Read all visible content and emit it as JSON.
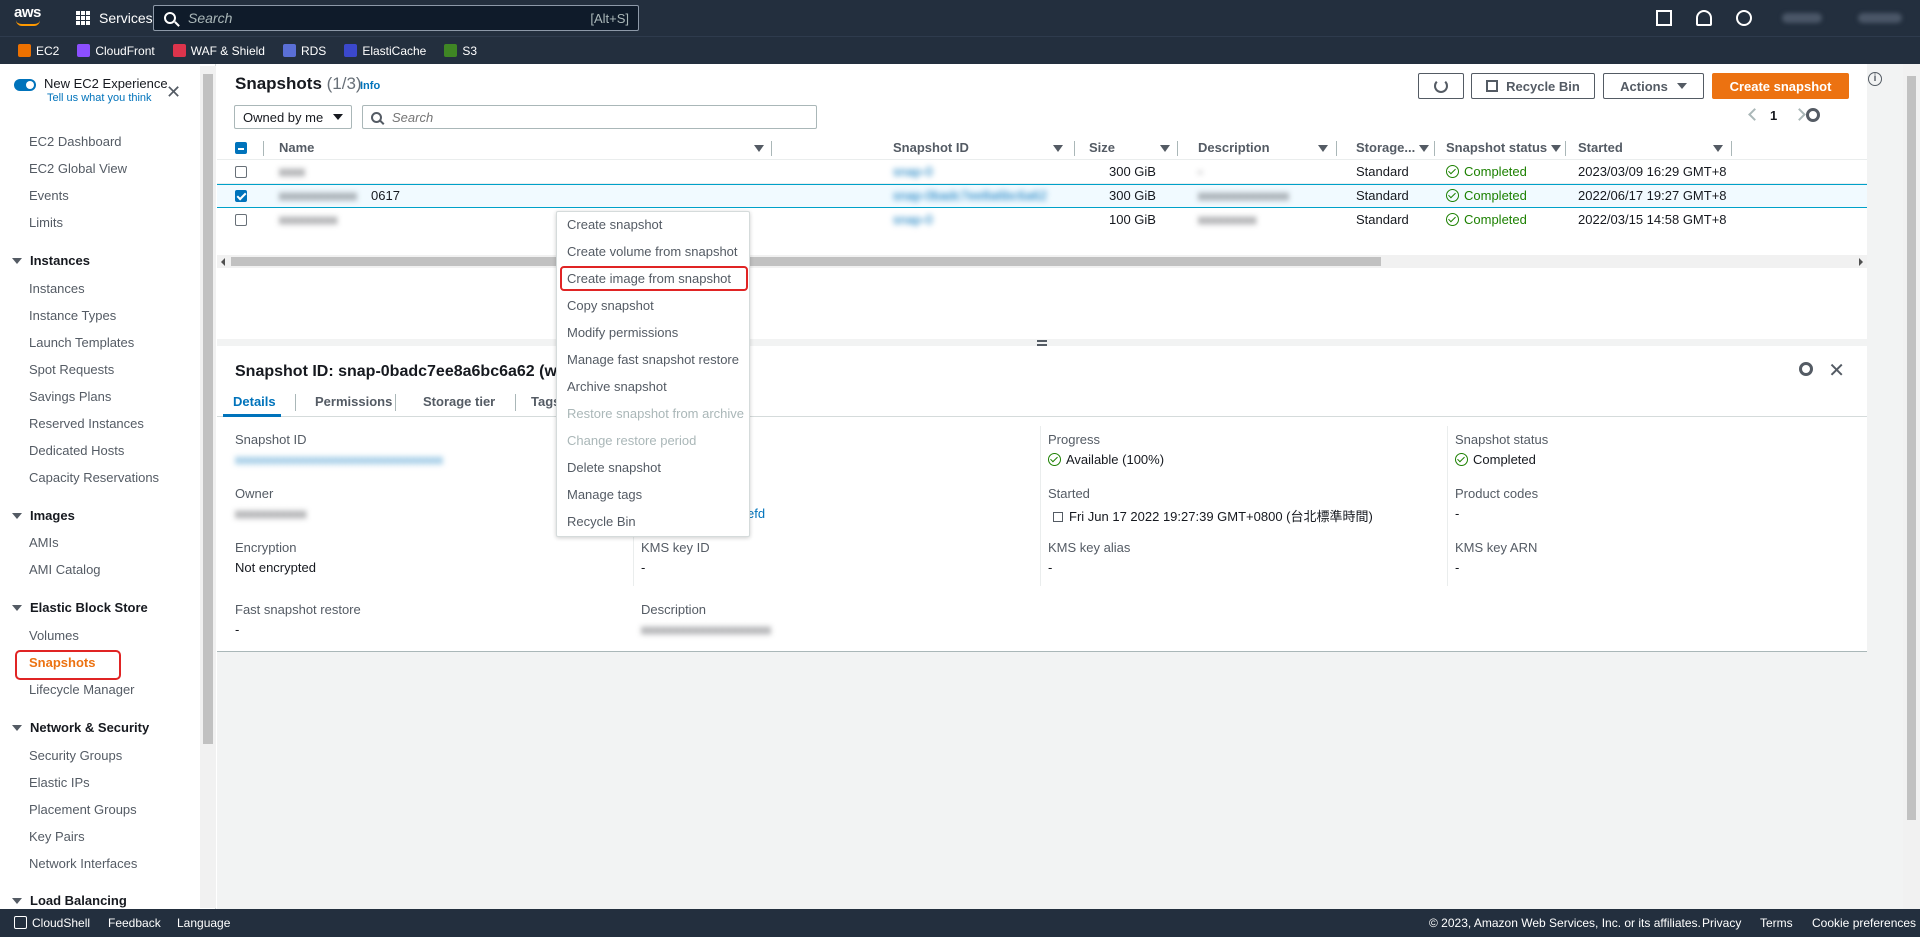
{
  "topnav": {
    "logo_text": "aws",
    "services_label": "Services",
    "search_placeholder": "Search",
    "search_shortcut": "[Alt+S]"
  },
  "favorites": [
    {
      "label": "EC2",
      "color": "#ed7100"
    },
    {
      "label": "CloudFront",
      "color": "#8c4fff"
    },
    {
      "label": "WAF & Shield",
      "color": "#dd344c"
    },
    {
      "label": "RDS",
      "color": "#5a6fd6"
    },
    {
      "label": "ElastiCache",
      "color": "#3b48cc"
    },
    {
      "label": "S3",
      "color": "#3f8624"
    }
  ],
  "sidebar": {
    "experience_title": "New EC2 Experience",
    "experience_link": "Tell us what you think",
    "items_top": [
      "EC2 Dashboard",
      "EC2 Global View",
      "Events",
      "Limits"
    ],
    "sections": [
      {
        "title": "Instances",
        "items": [
          "Instances",
          "Instance Types",
          "Launch Templates",
          "Spot Requests",
          "Savings Plans",
          "Reserved Instances",
          "Dedicated Hosts",
          "Capacity Reservations"
        ]
      },
      {
        "title": "Images",
        "items": [
          "AMIs",
          "AMI Catalog"
        ]
      },
      {
        "title": "Elastic Block Store",
        "items": [
          "Volumes",
          "Snapshots",
          "Lifecycle Manager"
        ]
      },
      {
        "title": "Network & Security",
        "items": [
          "Security Groups",
          "Elastic IPs",
          "Placement Groups",
          "Key Pairs",
          "Network Interfaces"
        ]
      },
      {
        "title": "Load Balancing",
        "items": []
      }
    ],
    "active_item": "Snapshots"
  },
  "toolbar": {
    "title": "Snapshots",
    "count": "(1/3)",
    "info": "Info",
    "recycle_bin": "Recycle Bin",
    "actions": "Actions",
    "create_snapshot": "Create snapshot",
    "owner_filter": "Owned by me",
    "search_placeholder": "Search",
    "page": "1"
  },
  "table": {
    "columns": [
      "Name",
      "Snapshot ID",
      "Size",
      "Description",
      "Storage...",
      "Snapshot status",
      "Started"
    ],
    "rows": [
      {
        "name": "",
        "name_suffix": "",
        "snapshot_id": "snap-0",
        "size": "300 GiB",
        "description": "-",
        "storage": "Standard",
        "status": "Completed",
        "started": "2023/03/09 16:29 GMT+8",
        "selected": false
      },
      {
        "name": "",
        "name_suffix": "0617",
        "snapshot_id": "snap-0badc7ee8a6bc6a62",
        "size": "300 GiB",
        "description": "",
        "storage": "Standard",
        "status": "Completed",
        "started": "2022/06/17 19:27 GMT+8",
        "selected": true
      },
      {
        "name": "",
        "name_suffix": "",
        "snapshot_id": "snap-0",
        "size": "100 GiB",
        "description": "",
        "storage": "Standard",
        "status": "Completed",
        "started": "2022/03/15 14:58 GMT+8",
        "selected": false
      }
    ]
  },
  "context_menu": {
    "items": [
      {
        "label": "Create snapshot",
        "disabled": false
      },
      {
        "label": "Create volume from snapshot",
        "disabled": false
      },
      {
        "label": "Create image from snapshot",
        "disabled": false
      },
      {
        "label": "Copy snapshot",
        "disabled": false
      },
      {
        "label": "Modify permissions",
        "disabled": false
      },
      {
        "label": "Manage fast snapshot restore",
        "disabled": false
      },
      {
        "label": "Archive snapshot",
        "disabled": false
      },
      {
        "label": "Restore snapshot from archive",
        "disabled": true
      },
      {
        "label": "Change restore period",
        "disabled": true
      },
      {
        "label": "Delete snapshot",
        "disabled": false
      },
      {
        "label": "Manage tags",
        "disabled": false
      },
      {
        "label": "Recycle Bin",
        "disabled": false
      }
    ],
    "highlighted": "Create image from snapshot"
  },
  "details": {
    "title": "Snapshot ID: snap-0badc7ee8a6bc6a62 (w",
    "tabs": [
      "Details",
      "Permissions",
      "Storage tier",
      "Tags"
    ],
    "active_tab": "Details",
    "fields": {
      "snapshot_id_label": "Snapshot ID",
      "owner_label": "Owner",
      "encryption_label": "Encryption",
      "encryption_value": "Not encrypted",
      "fast_restore_label": "Fast snapshot restore",
      "fast_restore_value": "-",
      "volume_partial": "efd",
      "kms_key_id_label": "KMS key ID",
      "kms_key_id_value": "-",
      "description_label": "Description",
      "progress_label": "Progress",
      "progress_value": "Available (100%)",
      "started_label": "Started",
      "started_value": "Fri Jun 17 2022 19:27:39 GMT+0800 (台北標準時間)",
      "kms_alias_label": "KMS key alias",
      "kms_alias_value": "-",
      "status_label": "Snapshot status",
      "status_value": "Completed",
      "product_codes_label": "Product codes",
      "product_codes_value": "-",
      "kms_arn_label": "KMS key ARN",
      "kms_arn_value": "-"
    }
  },
  "footer": {
    "cloudshell": "CloudShell",
    "feedback": "Feedback",
    "language": "Language",
    "copyright": "© 2023, Amazon Web Services, Inc. or its affiliates.",
    "privacy": "Privacy",
    "terms": "Terms",
    "cookies": "Cookie preferences"
  }
}
